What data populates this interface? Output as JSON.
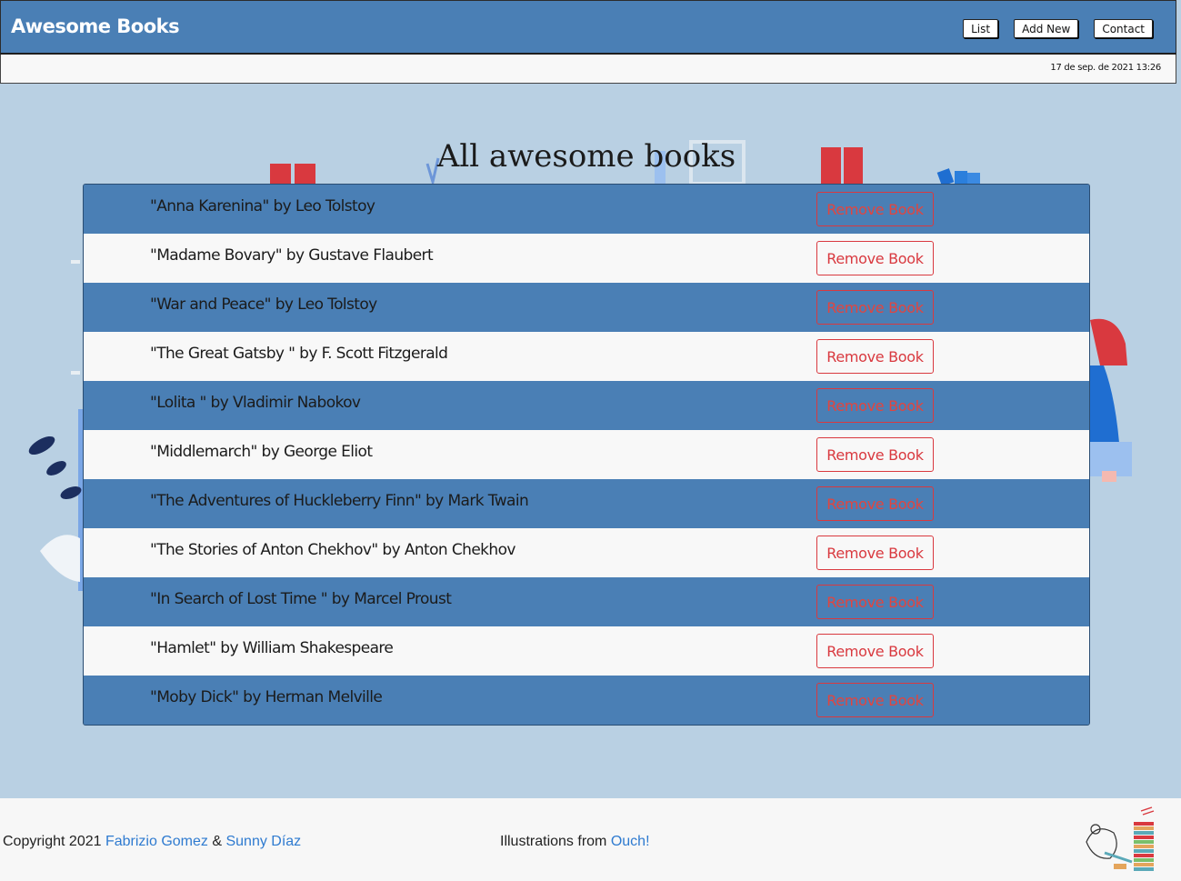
{
  "header": {
    "brand": "Awesome Books",
    "nav": [
      "List",
      "Add New",
      "Contact"
    ],
    "date": "17 de sep. de 2021 13:26"
  },
  "main": {
    "title": "All awesome books",
    "remove_label": "Remove Book",
    "books": [
      "\"Anna Karenina\" by Leo Tolstoy",
      "\"Madame Bovary\" by Gustave Flaubert",
      "\"War and Peace\" by Leo Tolstoy",
      "\"The Great Gatsby \" by F. Scott Fitzgerald",
      "\"Lolita \" by Vladimir Nabokov",
      "\"Middlemarch\" by George Eliot",
      "\"The Adventures of Huckleberry Finn\" by Mark Twain",
      "\"The Stories of Anton Chekhov\" by Anton Chekhov",
      "\"In Search of Lost Time \" by Marcel Proust",
      "\"Hamlet\" by William Shakespeare",
      "\"Moby Dick\" by Herman Melville"
    ]
  },
  "footer": {
    "copyright_prefix": "Copyright 2021",
    "author1": "Fabrizio Gomez",
    "amp": "&",
    "author2": "Sunny Díaz",
    "illus_prefix": "Illustrations from",
    "illus_link": "Ouch!"
  },
  "colors": {
    "header": "#4a7fb5",
    "background": "#b9d0e3",
    "accent_red": "#d9393f",
    "link": "#2f7bd0"
  },
  "icons": [
    "books-illustration",
    "reader-illustration"
  ]
}
